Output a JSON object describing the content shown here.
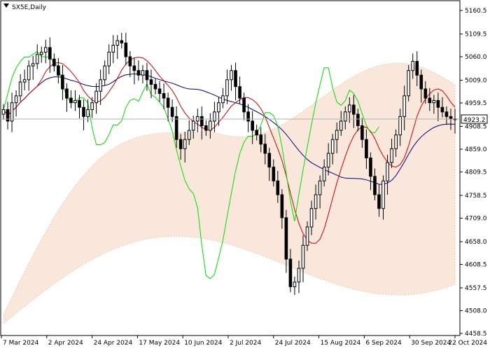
{
  "chart_data": {
    "type": "candlestick",
    "symbol_label": "SX5E,Daily",
    "current_price": "4923.2",
    "y_ticks": [
      "5160.5",
      "5109.5",
      "5060.0",
      "5009.0",
      "4959.5",
      "4908.5",
      "4859.0",
      "4809.5",
      "4758.5",
      "4709.0",
      "4658.0",
      "4608.5",
      "4557.5",
      "4508.0",
      "4458.5"
    ],
    "ylim": [
      4458.5,
      5160.5
    ],
    "x_ticks": [
      "7 Mar 2024",
      "2 Apr 2024",
      "24 Apr 2024",
      "17 May 2024",
      "10 Jun 2024",
      "2 Jul 2024",
      "24 Jul 2024",
      "15 Aug 2024",
      "6 Sep 2024",
      "30 Sep 2024",
      "22 Oct 2024"
    ],
    "series": [
      {
        "name": "close",
        "values": [
          4945,
          4920,
          4960,
          4975,
          5005,
          5010,
          5040,
          5045,
          5065,
          5070,
          5080,
          5055,
          5040,
          5020,
          4990,
          4970,
          4960,
          4965,
          4950,
          4930,
          4945,
          4960,
          4985,
          5010,
          5040,
          5070,
          5085,
          5095,
          5090,
          5060,
          5040,
          5030,
          5020,
          5030,
          5010,
          5000,
          4990,
          4980,
          4970,
          4950,
          4930,
          4880,
          4860,
          4880,
          4900,
          4920,
          4930,
          4910,
          4900,
          4920,
          4940,
          4960,
          4975,
          5010,
          5030,
          4995,
          4970,
          4940,
          4920,
          4900,
          4890,
          4870,
          4850,
          4820,
          4790,
          4760,
          4710,
          4620,
          4560,
          4570,
          4600,
          4650,
          4690,
          4730,
          4760,
          4790,
          4820,
          4850,
          4880,
          4900,
          4920,
          4940,
          4955,
          4935,
          4910,
          4880,
          4840,
          4800,
          4760,
          4730,
          4790,
          4830,
          4860,
          4890,
          4930,
          4975,
          5030,
          5050,
          5020,
          4990,
          4970,
          4960,
          4965,
          4950,
          4940,
          4930,
          4925,
          4923
        ]
      },
      {
        "name": "tenkan-sen",
        "color": "#cc0000"
      },
      {
        "name": "kijun-sen",
        "color": "#000080"
      },
      {
        "name": "chikou-span",
        "color": "#00dd00"
      },
      {
        "name": "cloud",
        "color": "#e07a3a"
      }
    ]
  }
}
